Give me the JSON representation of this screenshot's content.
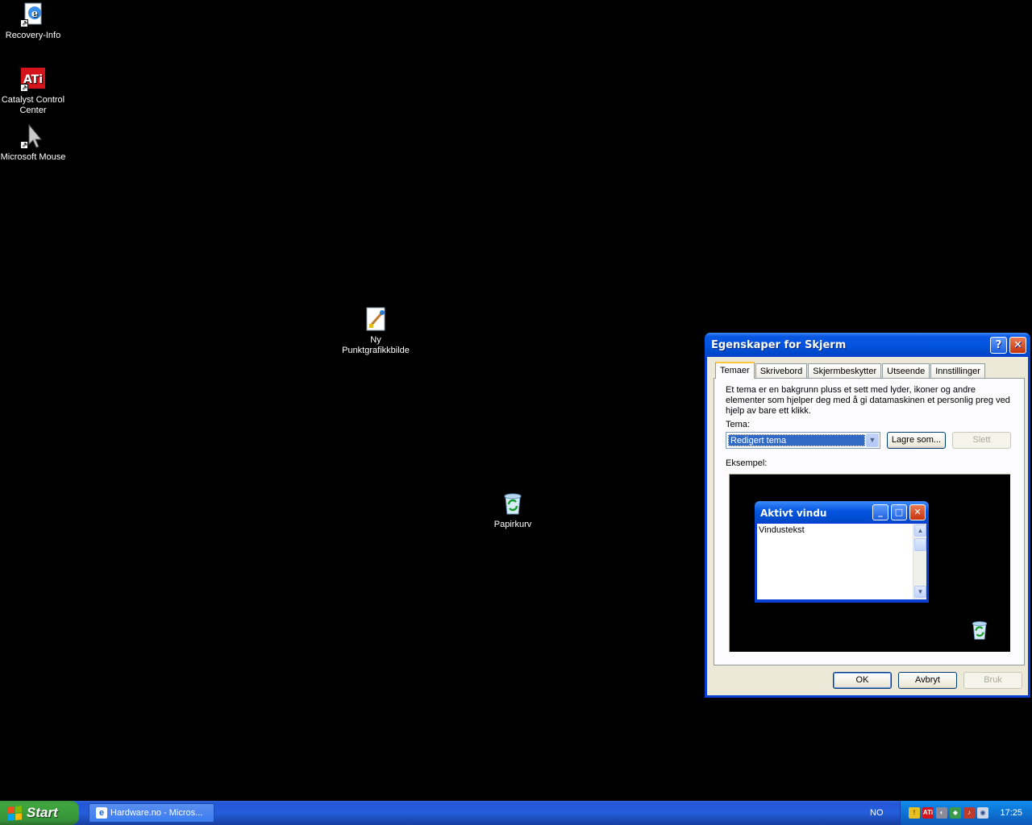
{
  "desktop": {
    "icons": [
      {
        "label": "Recovery-Info",
        "icon": "internet-shortcut-icon"
      },
      {
        "label": "Catalyst Control Center",
        "icon": "ati-icon"
      },
      {
        "label": "Microsoft Mouse",
        "icon": "mouse-pointer-icon"
      },
      {
        "label": "Ny Punktgrafikkbilde",
        "icon": "bitmap-image-icon"
      },
      {
        "label": "Papirkurv",
        "icon": "recycle-bin-icon"
      }
    ]
  },
  "dialog": {
    "title": "Egenskaper for Skjerm",
    "help_glyph": "?",
    "close_glyph": "✕",
    "tabs": [
      "Temaer",
      "Skrivebord",
      "Skjermbeskytter",
      "Utseende",
      "Innstillinger"
    ],
    "description": "Et tema er en bakgrunn pluss et sett med lyder, ikoner og andre elementer som hjelper deg med å gi datamaskinen et personlig preg ved hjelp av bare ett klikk.",
    "theme_label": "Tema:",
    "theme_value": "Redigert tema",
    "save_as_label": "Lagre som...",
    "delete_label": "Slett",
    "example_label": "Eksempel:",
    "preview": {
      "window_title": "Aktivt vindu",
      "window_text": "Vindustekst"
    },
    "ok_label": "OK",
    "cancel_label": "Avbryt",
    "apply_label": "Bruk"
  },
  "taskbar": {
    "start_label": "Start",
    "task_button": "Hardware.no - Micros...",
    "language": "NO",
    "clock": "17:25",
    "tray_icons": [
      "security-shield-icon",
      "ati-tray-icon",
      "sound-icon",
      "network-icon",
      "volume-icon",
      "update-icon"
    ]
  },
  "colors": {
    "titlebar_blue": "#0254e0",
    "taskbar_blue": "#245edb",
    "start_green": "#3ea53e",
    "desktop_bg": "#000000"
  }
}
